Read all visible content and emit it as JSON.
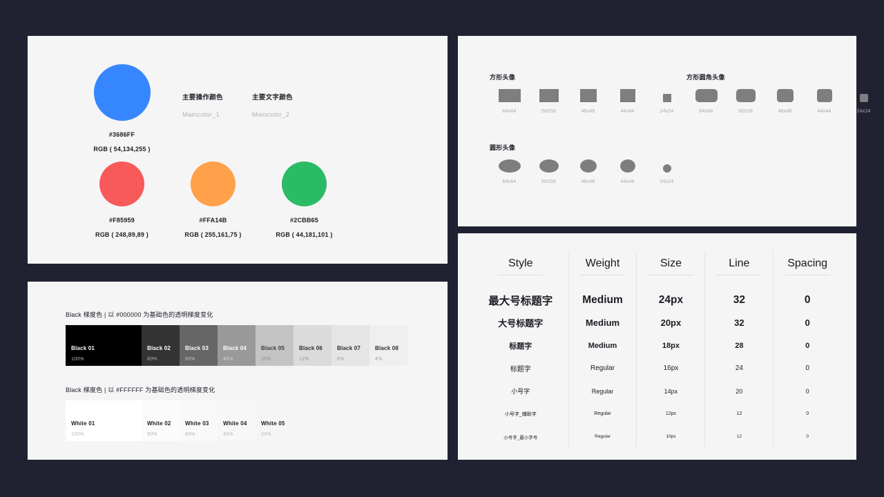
{
  "background_color": "#212231",
  "card_color": "#F5F5F6",
  "colors_card": {
    "main": {
      "hex": "#3686FF",
      "swatch_color": "#3686FF",
      "rgb": "RGB ( 54,134,255 )"
    },
    "notes": [
      {
        "title": "主要操作颜色",
        "sub": "Maincolor_1"
      },
      {
        "title": "主要文字颜色",
        "sub": "Maincolor_2"
      }
    ],
    "secondary": [
      {
        "hex": "#F85959",
        "swatch_color": "#F85959",
        "rgb": "RGB ( 248,89,89 )"
      },
      {
        "hex": "#FFA14B",
        "swatch_color": "#FFA14B",
        "rgb": "RGB ( 255,161,75 )"
      },
      {
        "hex": "#2CBB65",
        "swatch_color": "#2CBB65",
        "rgb": "RGB ( 44,181,101 )"
      }
    ]
  },
  "gradient_card": {
    "black": {
      "caption": "Black 梯度色 | 以 #000000 为基础色的透明梯度变化",
      "cells": [
        {
          "name": "Black 01",
          "percent": "100%",
          "bg": "#000000",
          "text": "#ffffff",
          "sub": "#b9b9b9",
          "width": 110
        },
        {
          "name": "Black 02",
          "percent": "80%",
          "bg": "#333333",
          "text": "#ffffff",
          "sub": "#b0b0b0",
          "width": 55
        },
        {
          "name": "Black 03",
          "percent": "60%",
          "bg": "#666666",
          "text": "#ffffff",
          "sub": "#c2c2c2",
          "width": 55
        },
        {
          "name": "Black 04",
          "percent": "40%",
          "bg": "#999999",
          "text": "#ffffff",
          "sub": "#d4d4d4",
          "width": 55
        },
        {
          "name": "Black 05",
          "percent": "20%",
          "bg": "#c4c4c4",
          "text": "#3a3a3a",
          "sub": "#8e8e8e",
          "width": 55
        },
        {
          "name": "Black 06",
          "percent": "12%",
          "bg": "#dbdbdb",
          "text": "#2c2c2c",
          "sub": "#9a9a9a",
          "width": 55
        },
        {
          "name": "Black 07",
          "percent": "8%",
          "bg": "#e5e5e5",
          "text": "#2c2c2c",
          "sub": "#a3a3a3",
          "width": 55
        },
        {
          "name": "Black 08",
          "percent": "4%",
          "bg": "#efefef",
          "text": "#2c2c2c",
          "sub": "#a8a8a8",
          "width": 55
        }
      ]
    },
    "white": {
      "caption": "Black 梯度色 | 以 #FFFFFF 为基础色的透明梯度变化",
      "cells": [
        {
          "name": "White 01",
          "percent": "100%",
          "bg": "#ffffff",
          "text": "#1d1d22",
          "sub": "#b6b6bb",
          "width": 110
        },
        {
          "name": "White 02",
          "percent": "80%",
          "bg": "#fbfbfb",
          "text": "#1d1d22",
          "sub": "#b6b6bb",
          "width": 55
        },
        {
          "name": "White 03",
          "percent": "60%",
          "bg": "#f9f9f9",
          "text": "#1d1d22",
          "sub": "#b6b6bb",
          "width": 55
        },
        {
          "name": "White 04",
          "percent": "40%",
          "bg": "#f7f7f7",
          "text": "#1d1d22",
          "sub": "#b6b6bb",
          "width": 55
        },
        {
          "name": "White 05",
          "percent": "20%",
          "bg": "#f5f5f5",
          "text": "#1d1d22",
          "sub": "#b6b6bb",
          "width": 55
        }
      ]
    }
  },
  "avatar_card": {
    "avatar_color": "#7E7E80",
    "groups": [
      {
        "title": "方形头像",
        "shape": "square",
        "items": [
          {
            "label": "64x64",
            "size": 32
          },
          {
            "label": "56X56",
            "size": 28
          },
          {
            "label": "48x48",
            "size": 24
          },
          {
            "label": "44x44",
            "size": 22
          },
          {
            "label": "24x24",
            "size": 12
          }
        ]
      },
      {
        "title": "方形圆角头像",
        "shape": "rounded",
        "items": [
          {
            "label": "64x64",
            "size": 32
          },
          {
            "label": "56X56",
            "size": 28
          },
          {
            "label": "48x48",
            "size": 24
          },
          {
            "label": "44x44",
            "size": 22
          },
          {
            "label": "24x24",
            "size": 12
          }
        ]
      },
      {
        "title": "圆形头像",
        "shape": "circle",
        "items": [
          {
            "label": "64x64",
            "size": 32
          },
          {
            "label": "56X56",
            "size": 28
          },
          {
            "label": "48x48",
            "size": 24
          },
          {
            "label": "44x44",
            "size": 22
          },
          {
            "label": "24x24",
            "size": 12
          }
        ]
      }
    ]
  },
  "type_card": {
    "headers": [
      "Style",
      "Weight",
      "Size",
      "Line",
      "Spacing"
    ],
    "rows": [
      {
        "style": "最大号标题字",
        "weight": "Medium",
        "size": "24px",
        "line": "32",
        "spacing": "0",
        "fs": 15.5
      },
      {
        "style": "大号标题字",
        "weight": "Medium",
        "size": "20px",
        "line": "32",
        "spacing": "0",
        "fs": 13
      },
      {
        "style": "标题字",
        "weight": "Medium",
        "size": "18px",
        "line": "28",
        "spacing": "0",
        "fs": 11
      },
      {
        "style": "标题字",
        "weight": "Regular",
        "size": "16px",
        "line": "24",
        "spacing": "0",
        "fs": 10
      },
      {
        "style": "小号字",
        "weight": "Regular",
        "size": "14px",
        "line": "20",
        "spacing": "0",
        "fs": 9
      },
      {
        "style": "小号字_辅助字",
        "weight": "Regular",
        "size": "12px",
        "line": "12",
        "spacing": "0",
        "fs": 7
      },
      {
        "style": "小号字_最小字号",
        "weight": "Regular",
        "size": "10px",
        "line": "12",
        "spacing": "0",
        "fs": 6.5
      }
    ]
  }
}
